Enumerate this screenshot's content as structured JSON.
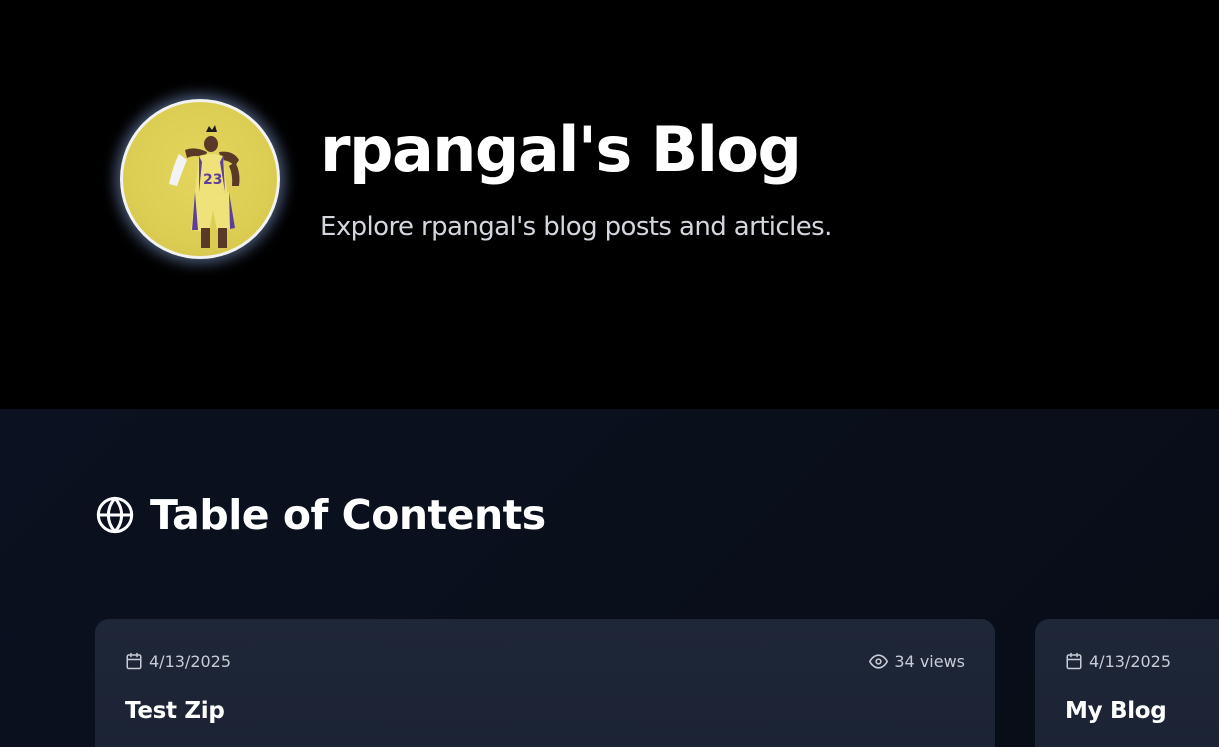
{
  "header": {
    "title": "rpangal's Blog",
    "subtitle": "Explore rpangal's blog posts and articles."
  },
  "toc": {
    "heading": "Table of Contents",
    "icon": "globe-icon"
  },
  "posts": [
    {
      "date": "4/13/2025",
      "views": "34 views",
      "title": "Test Zip"
    },
    {
      "date": "4/13/2025",
      "title": "My Blog"
    }
  ],
  "colors": {
    "hero_background": "#000000",
    "content_background": "#0b1120",
    "card_background": "#1e2738",
    "avatar_background": "#dccd53"
  }
}
